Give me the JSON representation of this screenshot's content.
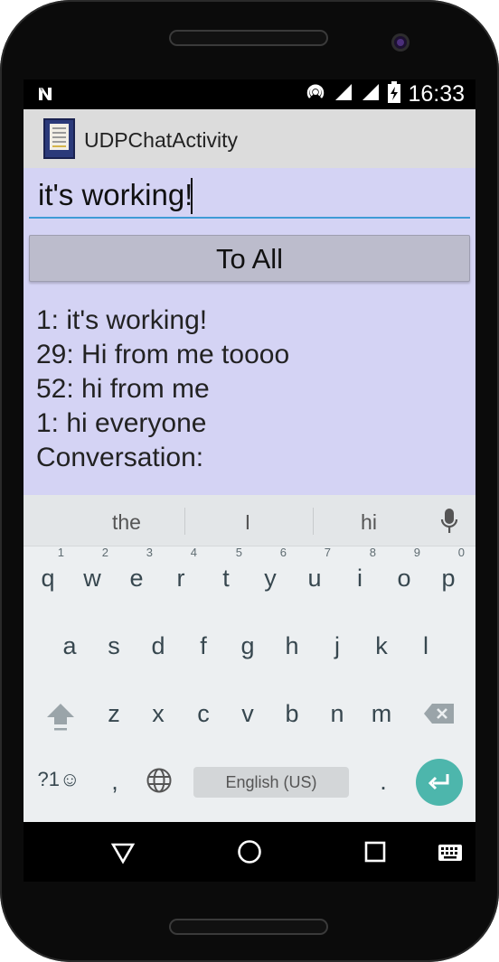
{
  "status_bar": {
    "time": "16:33"
  },
  "app_bar": {
    "title": "UDPChatActivity"
  },
  "message_input": {
    "value": "it's working!"
  },
  "send_button": {
    "label": "To All"
  },
  "conversation": {
    "lines": [
      "1: it's working!",
      "29: Hi from me toooo",
      "52: hi from me",
      "1: hi everyone",
      "Conversation:"
    ]
  },
  "keyboard": {
    "suggestions": [
      "the",
      "I",
      "hi"
    ],
    "row1": [
      {
        "key": "q",
        "hint": "1"
      },
      {
        "key": "w",
        "hint": "2"
      },
      {
        "key": "e",
        "hint": "3"
      },
      {
        "key": "r",
        "hint": "4"
      },
      {
        "key": "t",
        "hint": "5"
      },
      {
        "key": "y",
        "hint": "6"
      },
      {
        "key": "u",
        "hint": "7"
      },
      {
        "key": "i",
        "hint": "8"
      },
      {
        "key": "o",
        "hint": "9"
      },
      {
        "key": "p",
        "hint": "0"
      }
    ],
    "row2": [
      "a",
      "s",
      "d",
      "f",
      "g",
      "h",
      "j",
      "k",
      "l"
    ],
    "row3": [
      "z",
      "x",
      "c",
      "v",
      "b",
      "n",
      "m"
    ],
    "symbols_label": "?1☺",
    "comma": ",",
    "period": ".",
    "space_label": "English (US)",
    "accent_color": "#4db6ac"
  },
  "icons": {
    "status": [
      "notification-n-icon",
      "hotspot-icon",
      "signal-icon",
      "signal-icon",
      "battery-charging-icon"
    ],
    "nav": [
      "back-icon",
      "home-icon",
      "recents-icon",
      "keyboard-switch-icon"
    ]
  }
}
